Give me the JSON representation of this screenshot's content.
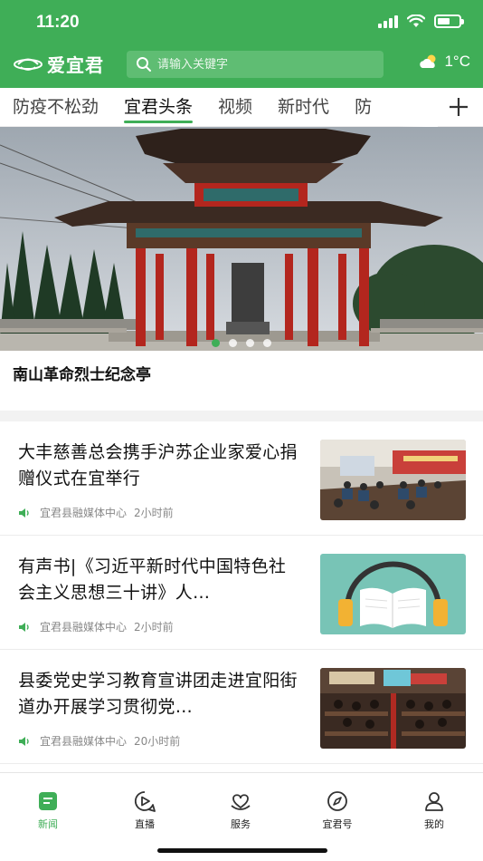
{
  "status_bar": {
    "time": "11:20"
  },
  "header": {
    "logo_text": "爱宜君",
    "search_placeholder": "请输入关键字",
    "weather": {
      "temperature": "1°C",
      "icon": "partly-cloudy-icon"
    }
  },
  "tabs": {
    "items": [
      {
        "label": "防疫不松劲",
        "active": false
      },
      {
        "label": "宜君头条",
        "active": true
      },
      {
        "label": "视频",
        "active": false
      },
      {
        "label": "新时代",
        "active": false
      },
      {
        "label": "防",
        "active": false
      }
    ],
    "add_icon": "plus-icon"
  },
  "hero": {
    "caption": "南山革命烈士纪念亭",
    "slide_count": 4,
    "active_slide": 1
  },
  "news": [
    {
      "title": "大丰慈善总会携手沪苏企业家爱心捐赠仪式在宜举行",
      "source": "宜君县融媒体中心",
      "time": "2小时前",
      "audio_icon": "speaker-icon",
      "thumb": "meeting-room-photo"
    },
    {
      "title": "有声书|《习近平新时代中国特色社会主义思想三十讲》人…",
      "source": "宜君县融媒体中心",
      "time": "2小时前",
      "audio_icon": "speaker-icon",
      "thumb": "book-headphones-illustration"
    },
    {
      "title": "县委党史学习教育宣讲团走进宜阳街道办开展学习贯彻党…",
      "source": "宜君县融媒体中心",
      "time": "20小时前",
      "audio_icon": "speaker-icon",
      "thumb": "lecture-hall-photo"
    }
  ],
  "bottom_nav": {
    "items": [
      {
        "label": "新闻",
        "icon": "news-icon",
        "active": true
      },
      {
        "label": "直播",
        "icon": "live-play-icon",
        "active": false
      },
      {
        "label": "服务",
        "icon": "service-heart-icon",
        "active": false
      },
      {
        "label": "宜君号",
        "icon": "compass-icon",
        "active": false
      },
      {
        "label": "我的",
        "icon": "user-icon",
        "active": false
      }
    ]
  },
  "colors": {
    "brand_green": "#3fae57",
    "search_bg": "#5fbd73",
    "meta_gray": "#888888"
  }
}
